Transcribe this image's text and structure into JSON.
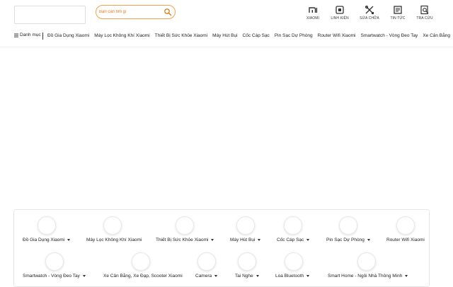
{
  "search": {
    "placeholder": "Bạn cần tìm gì"
  },
  "nav": [
    {
      "icon": "mi-logo-icon",
      "label": "XIAOMI"
    },
    {
      "icon": "component-icon",
      "label": "LINH KIỆN"
    },
    {
      "icon": "tools-icon",
      "label": "SỬA CHỮA"
    },
    {
      "icon": "news-icon",
      "label": "TIN TỨC"
    },
    {
      "icon": "lookup-icon",
      "label": "TRA CỨU"
    }
  ],
  "catbar": {
    "menu_label": "Danh mục",
    "items": [
      "Đồ Gia Dụng Xiaomi",
      "Máy Lọc Không Khí Xiaomi",
      "Thiết Bị Sức Khỏe Xiaomi",
      "Máy Hút Bụi",
      "Cốc Cáp Sạc",
      "Pin Sạc Dự Phòng",
      "Router Wifi Xiaomi",
      "Smartwatch - Vòng Đeo Tay",
      "Xe Cân Bằng"
    ]
  },
  "panel": {
    "row1": [
      {
        "label": "Đồ Gia Dụng Xiaomi",
        "dropdown": true
      },
      {
        "label": "Máy Lọc Không Khí Xiaomi",
        "dropdown": false
      },
      {
        "label": "Thiết Bị Sức Khỏe Xiaomi",
        "dropdown": true
      },
      {
        "label": "Máy Hút Bụi",
        "dropdown": true
      },
      {
        "label": "Cốc Cáp Sạc",
        "dropdown": true
      },
      {
        "label": "Pin Sạc Dự Phòng",
        "dropdown": true
      },
      {
        "label": "Router Wifi Xiaomi",
        "dropdown": false
      }
    ],
    "row2": [
      {
        "label": "Smartwatch - Vòng Đeo Tay",
        "dropdown": true
      },
      {
        "label": "Xe Cân Bằng, Xe Đạp, Scooter Xiaomi",
        "dropdown": false
      },
      {
        "label": "Camera",
        "dropdown": true
      },
      {
        "label": "Tai Nghe",
        "dropdown": true
      },
      {
        "label": "Loa Bluetooth",
        "dropdown": true
      },
      {
        "label": "Smart Home - Ngôi Nhà Thông Minh",
        "dropdown": true
      }
    ]
  },
  "colors": {
    "accent": "#f5a04a",
    "placeholder": "#e07b17"
  }
}
